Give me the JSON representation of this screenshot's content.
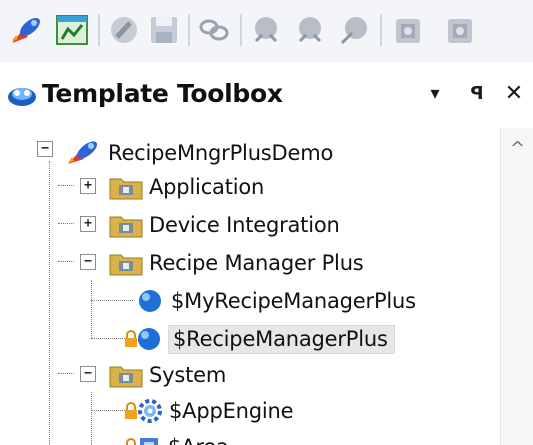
{
  "toolbar": {
    "icons": [
      "rocket-icon",
      "dashboard-icon",
      "edit-icon",
      "save-icon",
      "link-icon",
      "deploy-icon",
      "undeploy-icon",
      "upload-icon",
      "import-icon",
      "export-icon"
    ]
  },
  "panel": {
    "title": "Template Toolbox",
    "dropdown_glyph": "▾",
    "pin_glyph": "ꟼ",
    "close_glyph": "✕"
  },
  "tree": {
    "root": "RecipeMngrPlusDemo",
    "expand_collapse": {
      "expanded": "−",
      "collapsed": "+"
    },
    "items": [
      {
        "label": "Application",
        "state": "collapsed"
      },
      {
        "label": "Device Integration",
        "state": "collapsed"
      },
      {
        "label": "Recipe Manager Plus",
        "state": "expanded"
      },
      {
        "label": "$MyRecipeManagerPlus"
      },
      {
        "label": "$RecipeManagerPlus",
        "selected": true
      },
      {
        "label": "System",
        "state": "expanded"
      },
      {
        "label": "$AppEngine"
      },
      {
        "label": "$Area"
      }
    ]
  },
  "scrollbar": {
    "up_glyph": "^"
  },
  "colors": {
    "folder": "#d8b24a",
    "ball": "#1f6fd6",
    "lock": "#f0a21b",
    "selected_bg": "#e7e7e7"
  }
}
